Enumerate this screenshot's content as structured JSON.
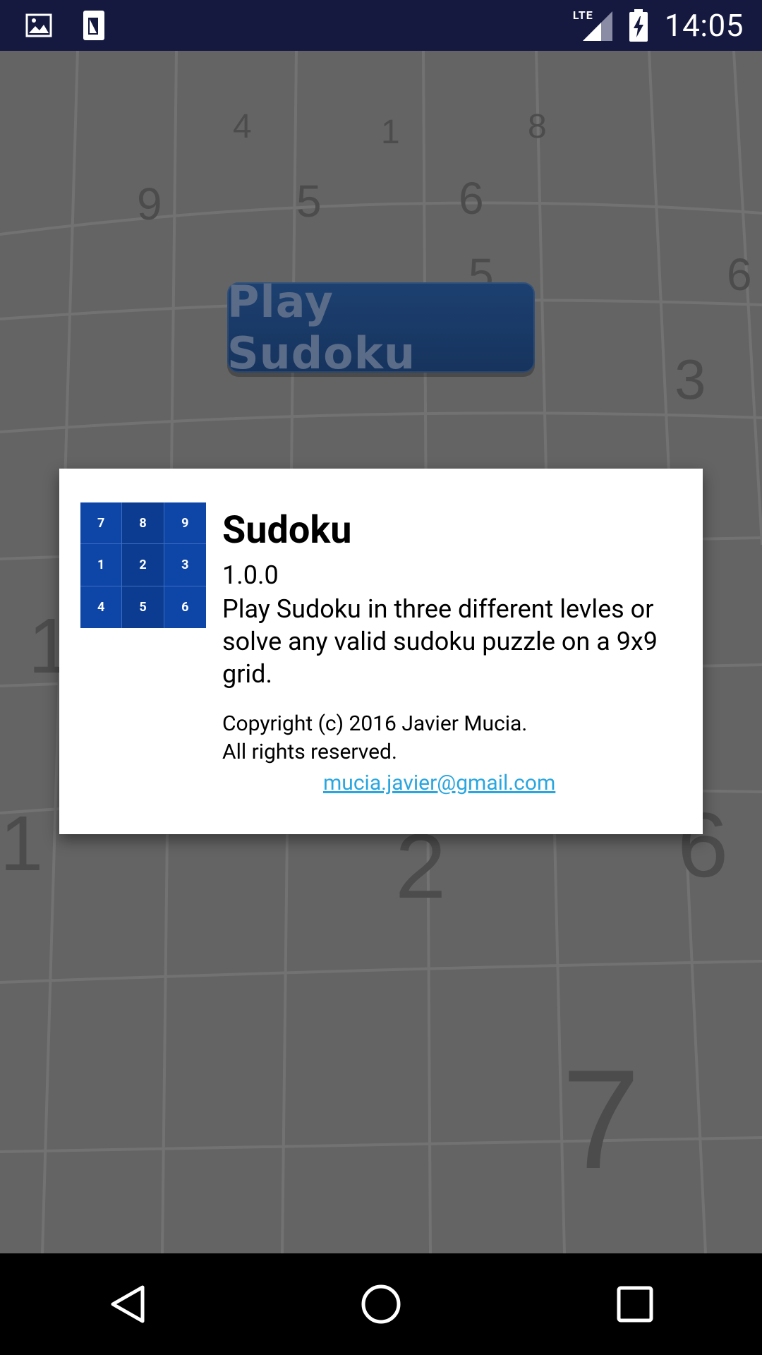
{
  "status_bar": {
    "time": "14:05",
    "network": "LTE",
    "icons": [
      "image-notification-icon",
      "sim-notification-icon",
      "signal-icon",
      "battery-charging-icon"
    ]
  },
  "background": {
    "play_button_label": "Play Sudoku",
    "digits": [
      "4",
      "1",
      "8",
      "9",
      "5",
      "6",
      "5",
      "6",
      "3",
      "1",
      "1",
      "2",
      "6",
      "7"
    ]
  },
  "dialog": {
    "logo_digits": [
      "7",
      "8",
      "9",
      "1",
      "2",
      "3",
      "4",
      "5",
      "6"
    ],
    "app_name": "Sudoku",
    "version": "1.0.0",
    "description": "Play Sudoku in three different levles or solve any valid sudoku puzzle on a 9x9 grid.",
    "copyright": "Copyright (c) 2016 Javier Mucia.\n All rights reserved.",
    "email": "mucia.javier@gmail.com"
  },
  "nav_bar": {
    "buttons": [
      "back-icon",
      "home-icon",
      "recents-icon"
    ]
  },
  "colors": {
    "status_bar": "#15193f",
    "logo_blue": "#0e46a8",
    "link": "#2aa6df"
  }
}
